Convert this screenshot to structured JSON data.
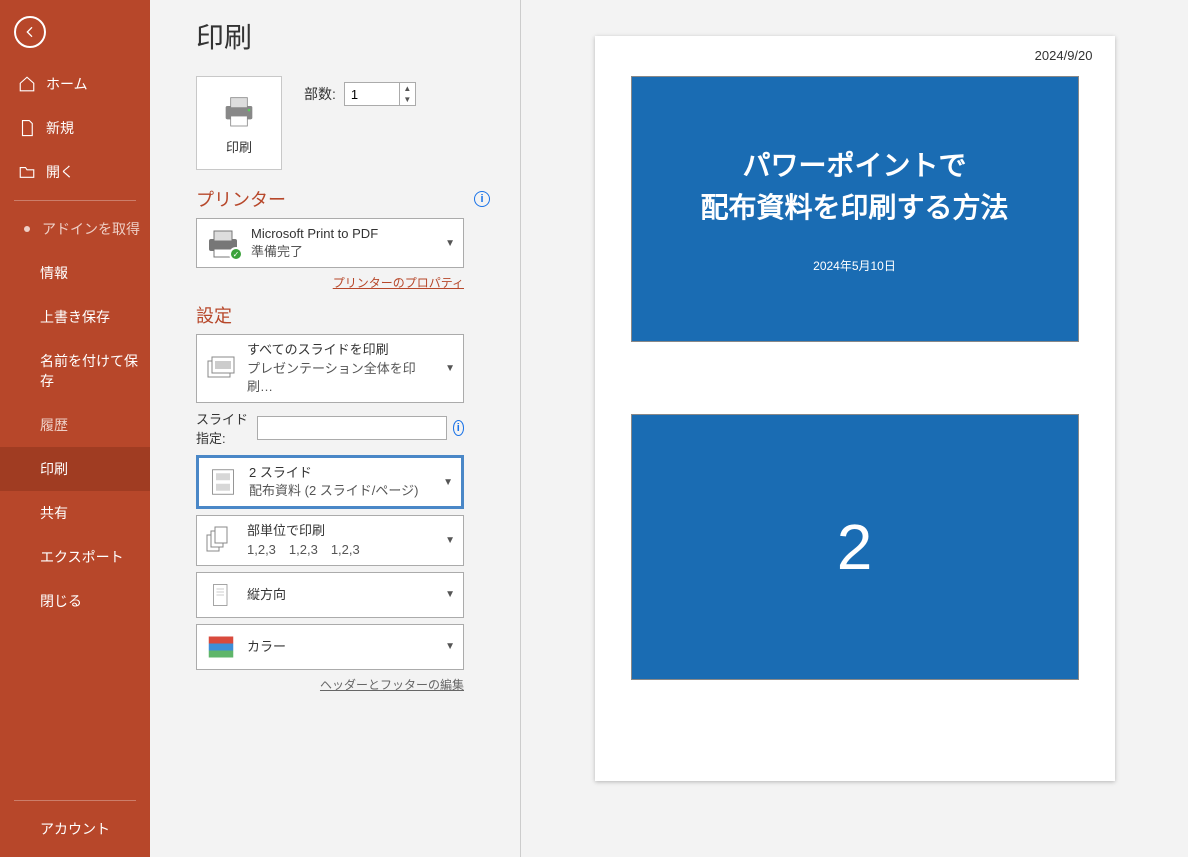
{
  "sidebar": {
    "home": "ホーム",
    "new": "新規",
    "open": "開く",
    "getaddins": "アドインを取得",
    "info": "情報",
    "save": "上書き保存",
    "saveas": "名前を付けて保存",
    "history": "履歴",
    "print": "印刷",
    "share": "共有",
    "export": "エクスポート",
    "close": "閉じる",
    "account": "アカウント"
  },
  "page": {
    "title": "印刷",
    "print_btn": "印刷",
    "copies_label": "部数:",
    "copies_value": "1"
  },
  "printer": {
    "heading": "プリンター",
    "name": "Microsoft Print to PDF",
    "status": "準備完了",
    "props": "プリンターのプロパティ"
  },
  "settings": {
    "heading": "設定",
    "range_title": "すべてのスライドを印刷",
    "range_sub": "プレゼンテーション全体を印刷…",
    "slides_label": "スライド指定:",
    "slides_value": "",
    "layout_title": "2 スライド",
    "layout_sub": "配布資料 (2 スライド/ページ)",
    "collate_title": "部単位で印刷",
    "collate_sub": "1,2,3　1,2,3　1,2,3",
    "orient": "縦方向",
    "color": "カラー",
    "hf": "ヘッダーとフッターの編集"
  },
  "preview": {
    "date": "2024/9/20",
    "slide1_l1": "パワーポイントで",
    "slide1_l2": "配布資料を印刷する方法",
    "slide1_date": "2024年5月10日",
    "slide2_big": "2"
  }
}
